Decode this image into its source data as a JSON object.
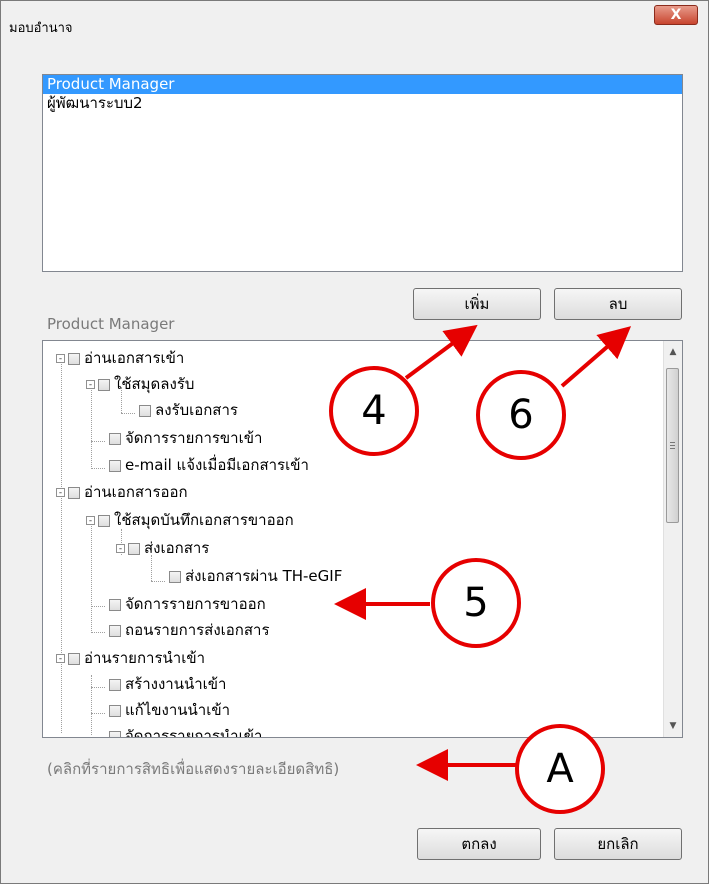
{
  "window": {
    "title": "มอบอำนาจ",
    "close_label": "X"
  },
  "roles_list": {
    "items": [
      {
        "label": "Product Manager",
        "selected": true
      },
      {
        "label": "ผู้พัฒนาระบบ2",
        "selected": false
      }
    ]
  },
  "buttons": {
    "add": "เพิ่ม",
    "delete": "ลบ",
    "ok": "ตกลง",
    "cancel": "ยกเลิก"
  },
  "permissions": {
    "section_label": "Product Manager",
    "tree": [
      {
        "label": "อ่านเอกสารเข้า",
        "level": 0,
        "expander": "-"
      },
      {
        "label": "ใช้สมุดลงรับ",
        "level": 1,
        "expander": "-"
      },
      {
        "label": "ลงรับเอกสาร",
        "level": 2,
        "expander": ""
      },
      {
        "label": "จัดการรายการขาเข้า",
        "level": 1,
        "expander": ""
      },
      {
        "label": "e-mail แจ้งเมื่อมีเอกสารเข้า",
        "level": 1,
        "expander": ""
      },
      {
        "label": "อ่านเอกสารออก",
        "level": 0,
        "expander": "-"
      },
      {
        "label": "ใช้สมุดบันทึกเอกสารขาออก",
        "level": 1,
        "expander": "-"
      },
      {
        "label": "ส่งเอกสาร",
        "level": 2,
        "expander": "-"
      },
      {
        "label": "ส่งเอกสารผ่าน TH-eGIF",
        "level": 3,
        "expander": ""
      },
      {
        "label": "จัดการรายการขาออก",
        "level": 1,
        "expander": ""
      },
      {
        "label": "ถอนรายการส่งเอกสาร",
        "level": 1,
        "expander": ""
      },
      {
        "label": "อ่านรายการนำเข้า",
        "level": 0,
        "expander": "-"
      },
      {
        "label": "สร้างงานนำเข้า",
        "level": 1,
        "expander": ""
      },
      {
        "label": "แก้ไขงานนำเข้า",
        "level": 1,
        "expander": ""
      },
      {
        "label": "จัดการรายการนำเข้า",
        "level": 1,
        "expander": ""
      }
    ],
    "hint": "(คลิกที่รายการสิทธิเพื่อแสดงรายละเอียดสิทธิ)"
  },
  "annotations": {
    "callout_4": "4",
    "callout_6": "6",
    "callout_5": "5",
    "callout_a": "A",
    "color": "#e60000"
  }
}
